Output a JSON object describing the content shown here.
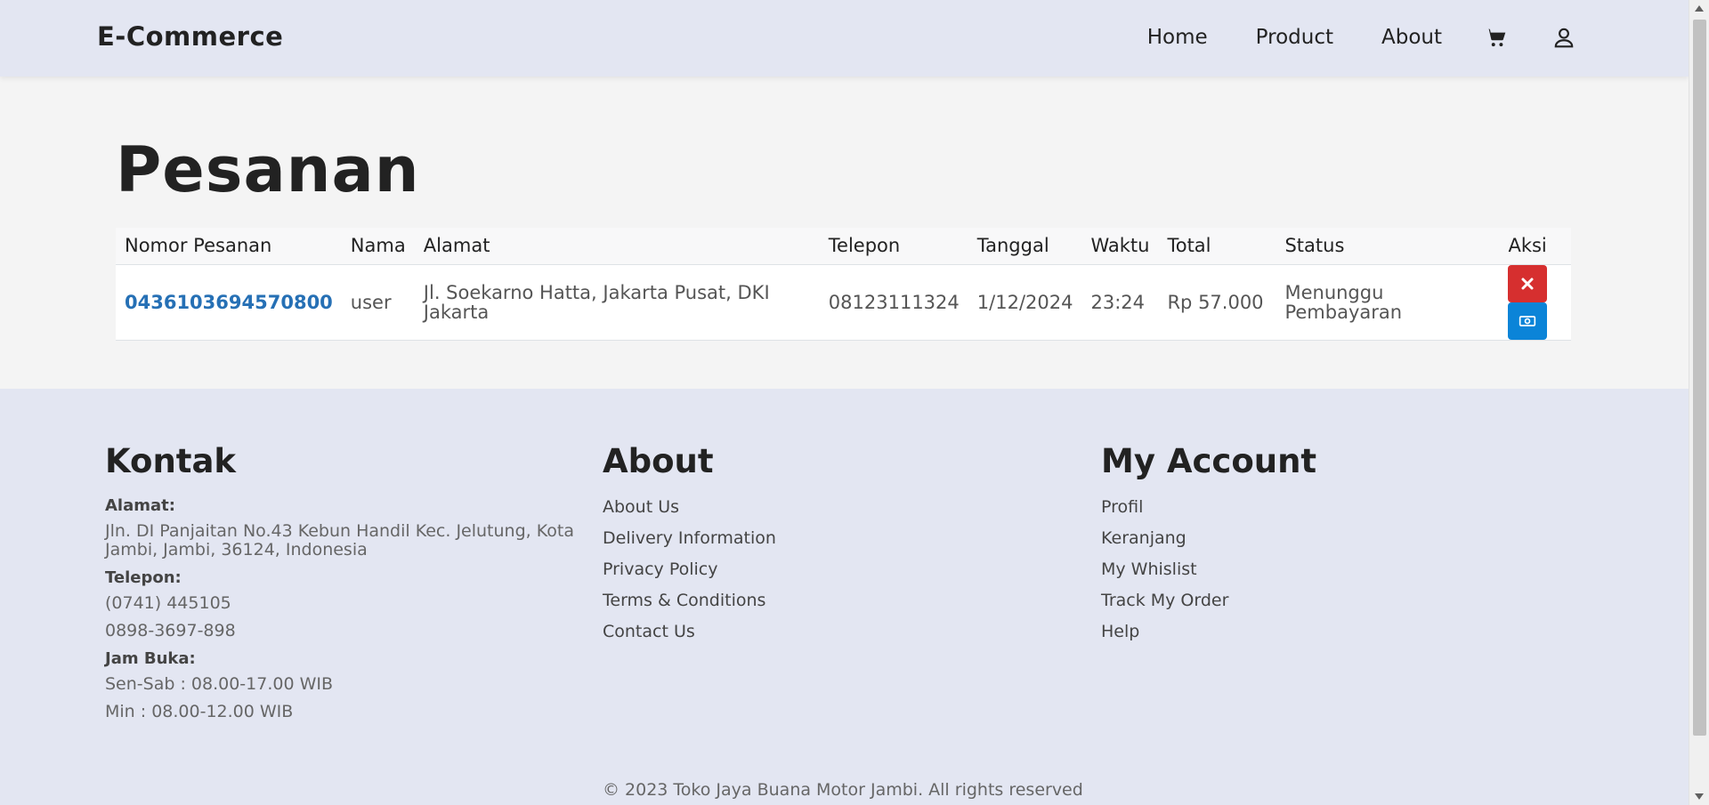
{
  "nav": {
    "brand": "E-Commerce",
    "links": [
      "Home",
      "Product",
      "About"
    ],
    "icons": [
      "cart-icon",
      "user-icon"
    ]
  },
  "page": {
    "title": "Pesanan"
  },
  "table": {
    "headers": [
      "Nomor Pesanan",
      "Nama",
      "Alamat",
      "Telepon",
      "Tanggal",
      "Waktu",
      "Total",
      "Status",
      "Aksi"
    ],
    "rows": [
      {
        "order_number": "0436103694570800",
        "name": "user",
        "address": "Jl. Soekarno Hatta, Jakarta Pusat, DKI Jakarta",
        "phone": "08123111324",
        "date": "1/12/2024",
        "time": "23:24",
        "total": "Rp 57.000",
        "status": "Menunggu Pembayaran",
        "actions": [
          "cancel-icon",
          "money-icon"
        ]
      }
    ]
  },
  "footer": {
    "contact": {
      "title": "Kontak",
      "address_label": "Alamat:",
      "address": "Jln. DI Panjaitan No.43 Kebun Handil Kec. Jelutung, Kota Jambi, Jambi, 36124, Indonesia",
      "phone_label": "Telepon:",
      "phone_1": "(0741) 445105",
      "phone_2": "0898-3697-898",
      "hours_label": "Jam Buka:",
      "hours_1": "Sen-Sab : 08.00-17.00 WIB",
      "hours_2": "Min : 08.00-12.00 WIB"
    },
    "about": {
      "title": "About",
      "links": [
        "About Us",
        "Delivery Information",
        "Privacy Policy",
        "Terms & Conditions",
        "Contact Us"
      ]
    },
    "account": {
      "title": "My Account",
      "links": [
        "Profil",
        "Keranjang",
        "My Whislist",
        "Track My Order",
        "Help"
      ]
    },
    "copyright": "© 2023 Toko Jaya Buana Motor Jambi. All rights reserved"
  },
  "colors": {
    "nav_bg": "#e3e6f2",
    "link_blue": "#2670b5",
    "btn_red": "#d62f2f",
    "btn_blue": "#0b84d8"
  }
}
